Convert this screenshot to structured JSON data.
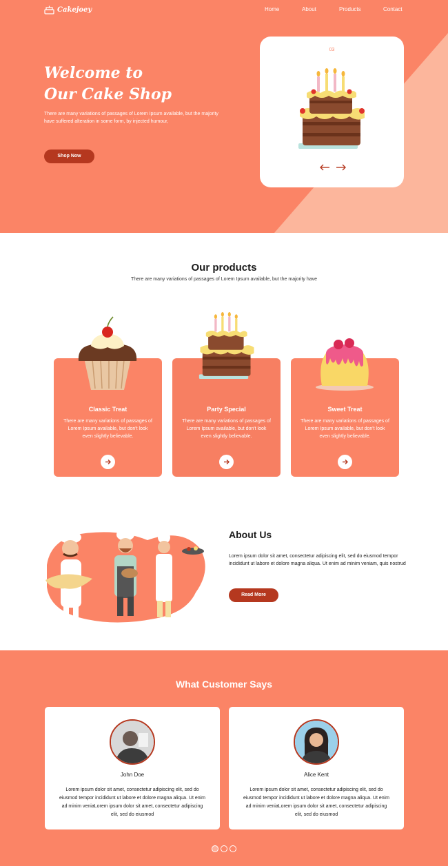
{
  "brand": {
    "name": "Cakejoey"
  },
  "nav": {
    "items": [
      "Home",
      "About",
      "Products",
      "Contact"
    ]
  },
  "hero": {
    "title_line1": "Welcome to",
    "title_line2": "Our Cake Shop",
    "text": "There are many variations of passages of Lorem Ipsum available, but the majority have suffered alteration in some form, by injected humour,",
    "button": "Shop Now",
    "slide_number": "03"
  },
  "products": {
    "title": "Our products",
    "subtitle": "There are many variations of passages of Lorem Ipsum available, but the majority have",
    "items": [
      {
        "name": "Classic Treat",
        "text": "There are many variations of passages of Lorem Ipsum available, but don't look even slightly believable."
      },
      {
        "name": "Party Special",
        "text": "There are many variations of passages of Lorem Ipsum available, but don't look even slightly believable."
      },
      {
        "name": "Sweet Treat",
        "text": "There are many variations of passages of Lorem Ipsum available, but don't look even slightly believable."
      }
    ]
  },
  "about": {
    "title": "About Us",
    "text": "Lorem ipsum dolor sit amet, consectetur adipiscing elit, sed do eiusmod tempor incididunt ut labore et dolore magna aliqua. Ut enim ad minim veniam, quis nostrud",
    "button": "Read More"
  },
  "testimonials": {
    "title": "What Customer Says",
    "items": [
      {
        "name": "John Doe",
        "text": "Lorem ipsum dolor sit amet, consectetur adipiscing elit, sed do eiusmod tempor incididunt ut labore et dolore magna aliqua. Ut enim ad minim veniaLorem ipsum dolor sit amet, consectetur adipiscing elit, sed do eiusmod"
      },
      {
        "name": "Alice Kent",
        "text": "Lorem ipsum dolor sit amet, consectetur adipiscing elit, sed do eiusmod tempor incididunt ut labore et dolore magna aliqua. Ut enim ad minim veniaLorem ipsum dolor sit amet, consectetur adipiscing elit, sed do eiusmod"
      }
    ]
  },
  "colors": {
    "primary": "#fb8466",
    "accent_dark": "#b5381f",
    "light_peach": "#fcb69c",
    "white": "#ffffff"
  },
  "icons": [
    "cake-logo-icon",
    "arrow-left-icon",
    "arrow-right-icon",
    "arrow-circle-right-icon"
  ]
}
